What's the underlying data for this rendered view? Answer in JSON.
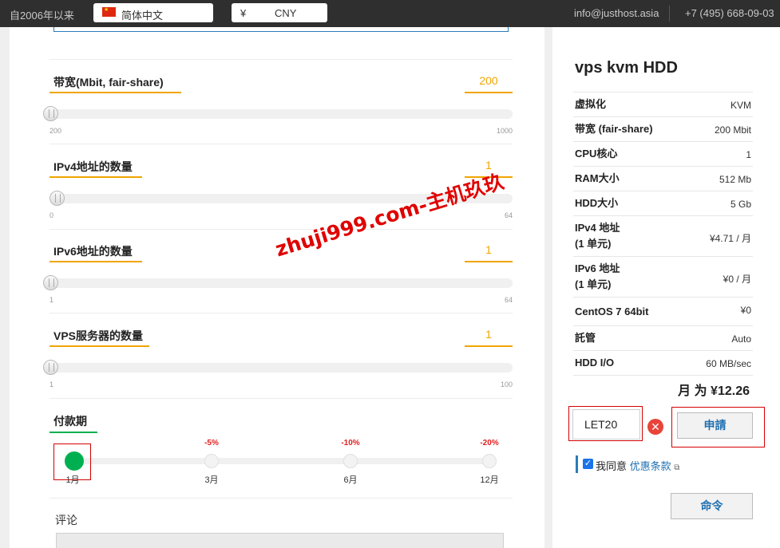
{
  "topbar": {
    "since": "自2006年以来",
    "language": "简体中文",
    "currency_symbol": "¥",
    "currency_code": "CNY",
    "email": "info@justhost.asia",
    "phone": "+7 (495) 668-09-03"
  },
  "sliders": [
    {
      "label": "带宽(Mbit, fair-share)",
      "value": "200",
      "min": "200",
      "max": "1000"
    },
    {
      "label": "IPv4地址的数量",
      "value": "1",
      "min": "0",
      "max": "64"
    },
    {
      "label": "IPv6地址的数量",
      "value": "1",
      "min": "1",
      "max": "64"
    },
    {
      "label": "VPS服务器的数量",
      "value": "1",
      "min": "1",
      "max": "100"
    }
  ],
  "payment": {
    "label": "付款期",
    "options": [
      {
        "label": "1月",
        "discount": "",
        "selected": true
      },
      {
        "label": "3月",
        "discount": "-5%",
        "selected": false
      },
      {
        "label": "6月",
        "discount": "-10%",
        "selected": false
      },
      {
        "label": "12月",
        "discount": "-20%",
        "selected": false
      }
    ]
  },
  "comment": {
    "label": "评论"
  },
  "watermark": "zhuji999.com-主机玖玖",
  "summary": {
    "title": "vps kvm HDD",
    "rows": [
      {
        "key": "虚拟化",
        "value": "KVM"
      },
      {
        "key": "带宽 (fair-share)",
        "value": "200 Mbit"
      },
      {
        "key": "CPU核心",
        "value": "1"
      },
      {
        "key": "RAM大小",
        "value": "512 Mb"
      },
      {
        "key": "HDD大小",
        "value": "5 Gb"
      },
      {
        "key": "IPv4 地址",
        "key2": "(1 单元)",
        "value": "¥4.71 / 月"
      },
      {
        "key": "IPv6 地址",
        "key2": "(1 单元)",
        "value": "¥0 / 月"
      },
      {
        "key": "CentOS 7 64bit",
        "value": "¥0"
      },
      {
        "key": "託管",
        "value": "Auto"
      },
      {
        "key": "HDD I/O",
        "value": "60 MB/sec"
      }
    ],
    "total": "月 为 ¥12.26"
  },
  "promo": {
    "value": "LET20",
    "apply_label": "申請"
  },
  "agree": {
    "text": "我同意 ",
    "link": "优惠条款"
  },
  "order_label": "命令"
}
